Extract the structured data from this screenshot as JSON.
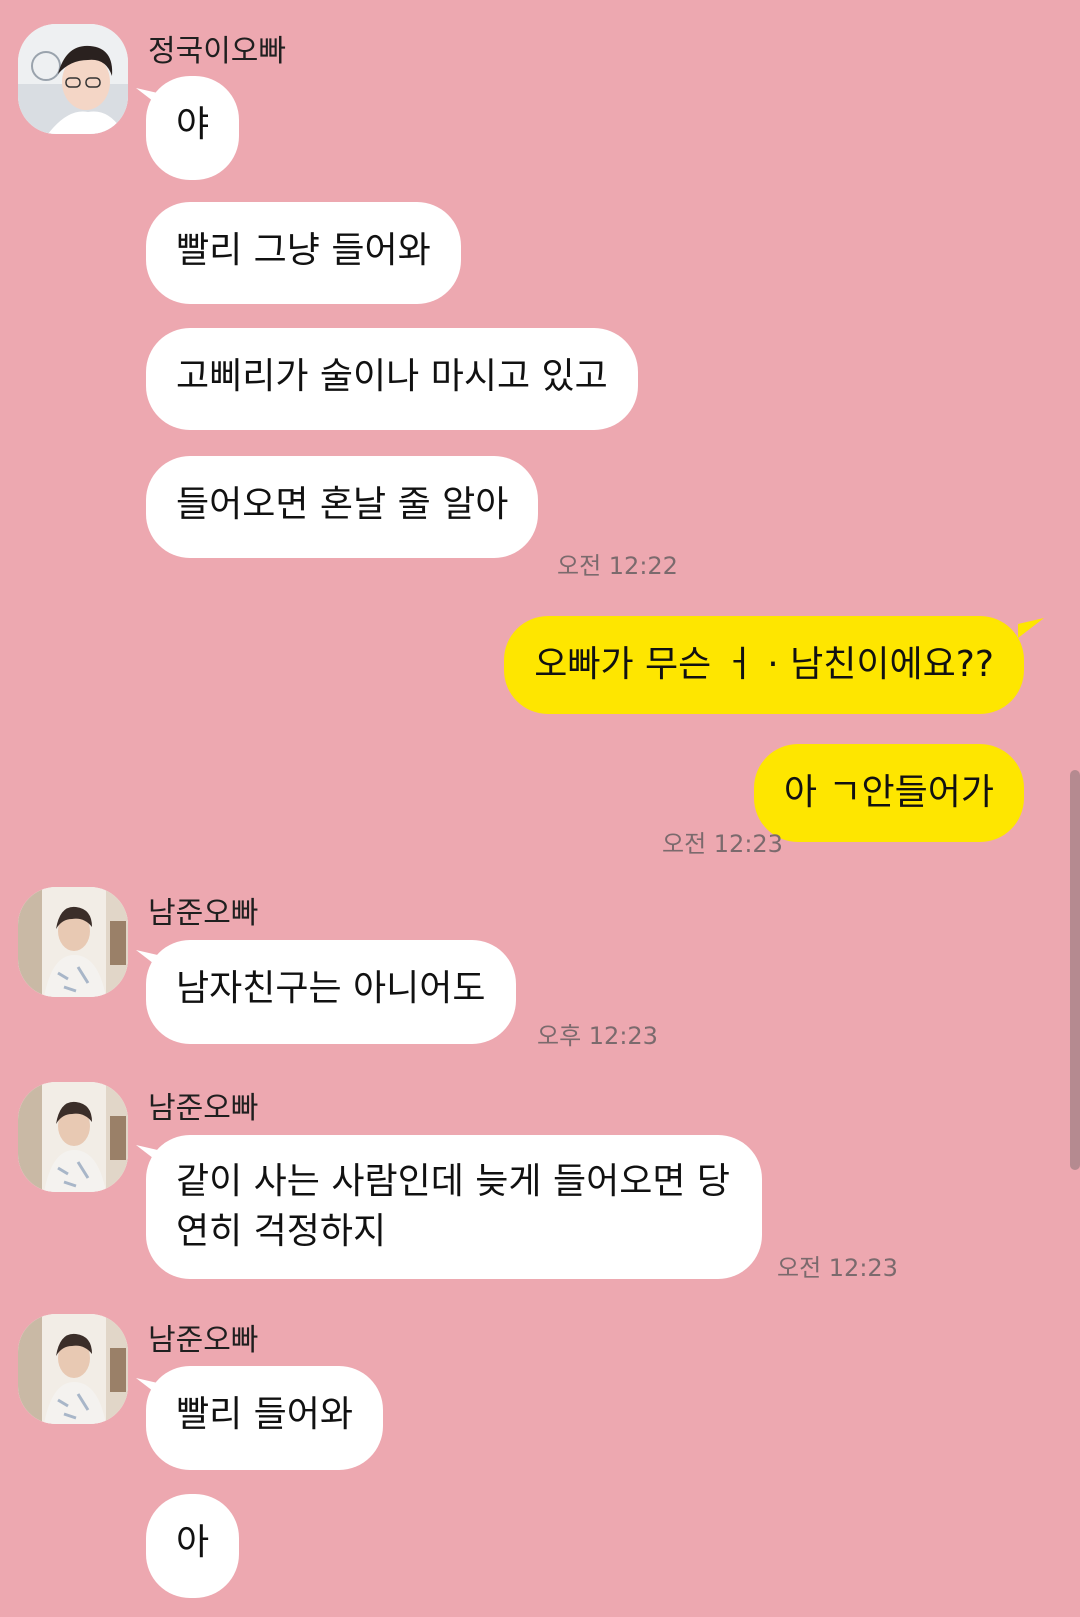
{
  "contacts": {
    "jungkook": "정국이오빠",
    "namjoon": "남준오빠"
  },
  "messages": {
    "m1": "야",
    "m2": "빨리 그냥 들어와",
    "m3": "고삐리가 술이나 마시고 있고",
    "m4": "들어오면 혼날 줄 알아",
    "t1": "오전 12:22",
    "o1": "오빠가 무슨 ㅓ · 남친이에요??",
    "o2": "아 ㄱ안들어가",
    "t2": "오전 12:23",
    "n1": "남자친구는 아니어도",
    "t3": "오후 12:23",
    "n2": "같이 사는 사람인데 늦게 들어오면 당연히 걱정하지",
    "t4": "오전 12:23",
    "n3": "빨리 들어와",
    "n4": "아"
  },
  "colors": {
    "background": "#eda8b0",
    "incoming_bubble": "#ffffff",
    "outgoing_bubble": "#fee600"
  }
}
